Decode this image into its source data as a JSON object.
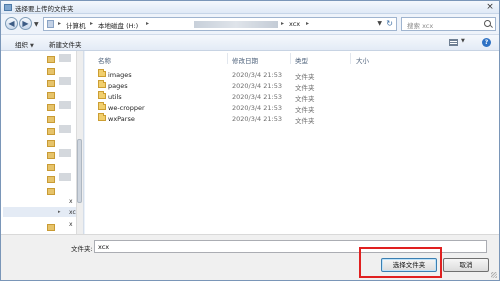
{
  "window": {
    "title": "选择要上传的文件夹",
    "close_glyph": "×"
  },
  "nav": {
    "back_glyph": "◀",
    "forward_glyph": "▶",
    "history_glyph": "▼",
    "refresh_glyph": "↻",
    "dropdown_glyph": "▼"
  },
  "address": {
    "segments": [
      "计算机",
      "本地磁盘 (H:)",
      "xcx"
    ],
    "separator": "▸"
  },
  "search": {
    "placeholder": "搜索 xcx"
  },
  "toolbar": {
    "organize_label": "组织",
    "new_folder_label": "新建文件夹",
    "dropdown_glyph": "▼",
    "help_glyph": "?"
  },
  "columns": {
    "name": "名称",
    "date": "修改日期",
    "type": "类型",
    "size": "大小"
  },
  "files": [
    {
      "name": "images",
      "date": "2020/3/4 21:53",
      "type": "文件夹"
    },
    {
      "name": "pages",
      "date": "2020/3/4 21:53",
      "type": "文件夹"
    },
    {
      "name": "utils",
      "date": "2020/3/4 21:53",
      "type": "文件夹"
    },
    {
      "name": "we-cropper",
      "date": "2020/3/4 21:53",
      "type": "文件夹"
    },
    {
      "name": "wxParse",
      "date": "2020/3/4 21:53",
      "type": "文件夹"
    }
  ],
  "navtree": {
    "selected_label": "xcx",
    "markers": [
      "x",
      "x"
    ]
  },
  "footer": {
    "folder_label": "文件夹:",
    "folder_value": "xcx",
    "select_button": "选择文件夹",
    "cancel_button": "取消"
  },
  "colors": {
    "highlight": "#e02020",
    "folder": "#f1cf6e",
    "header_text": "#4c607a"
  }
}
